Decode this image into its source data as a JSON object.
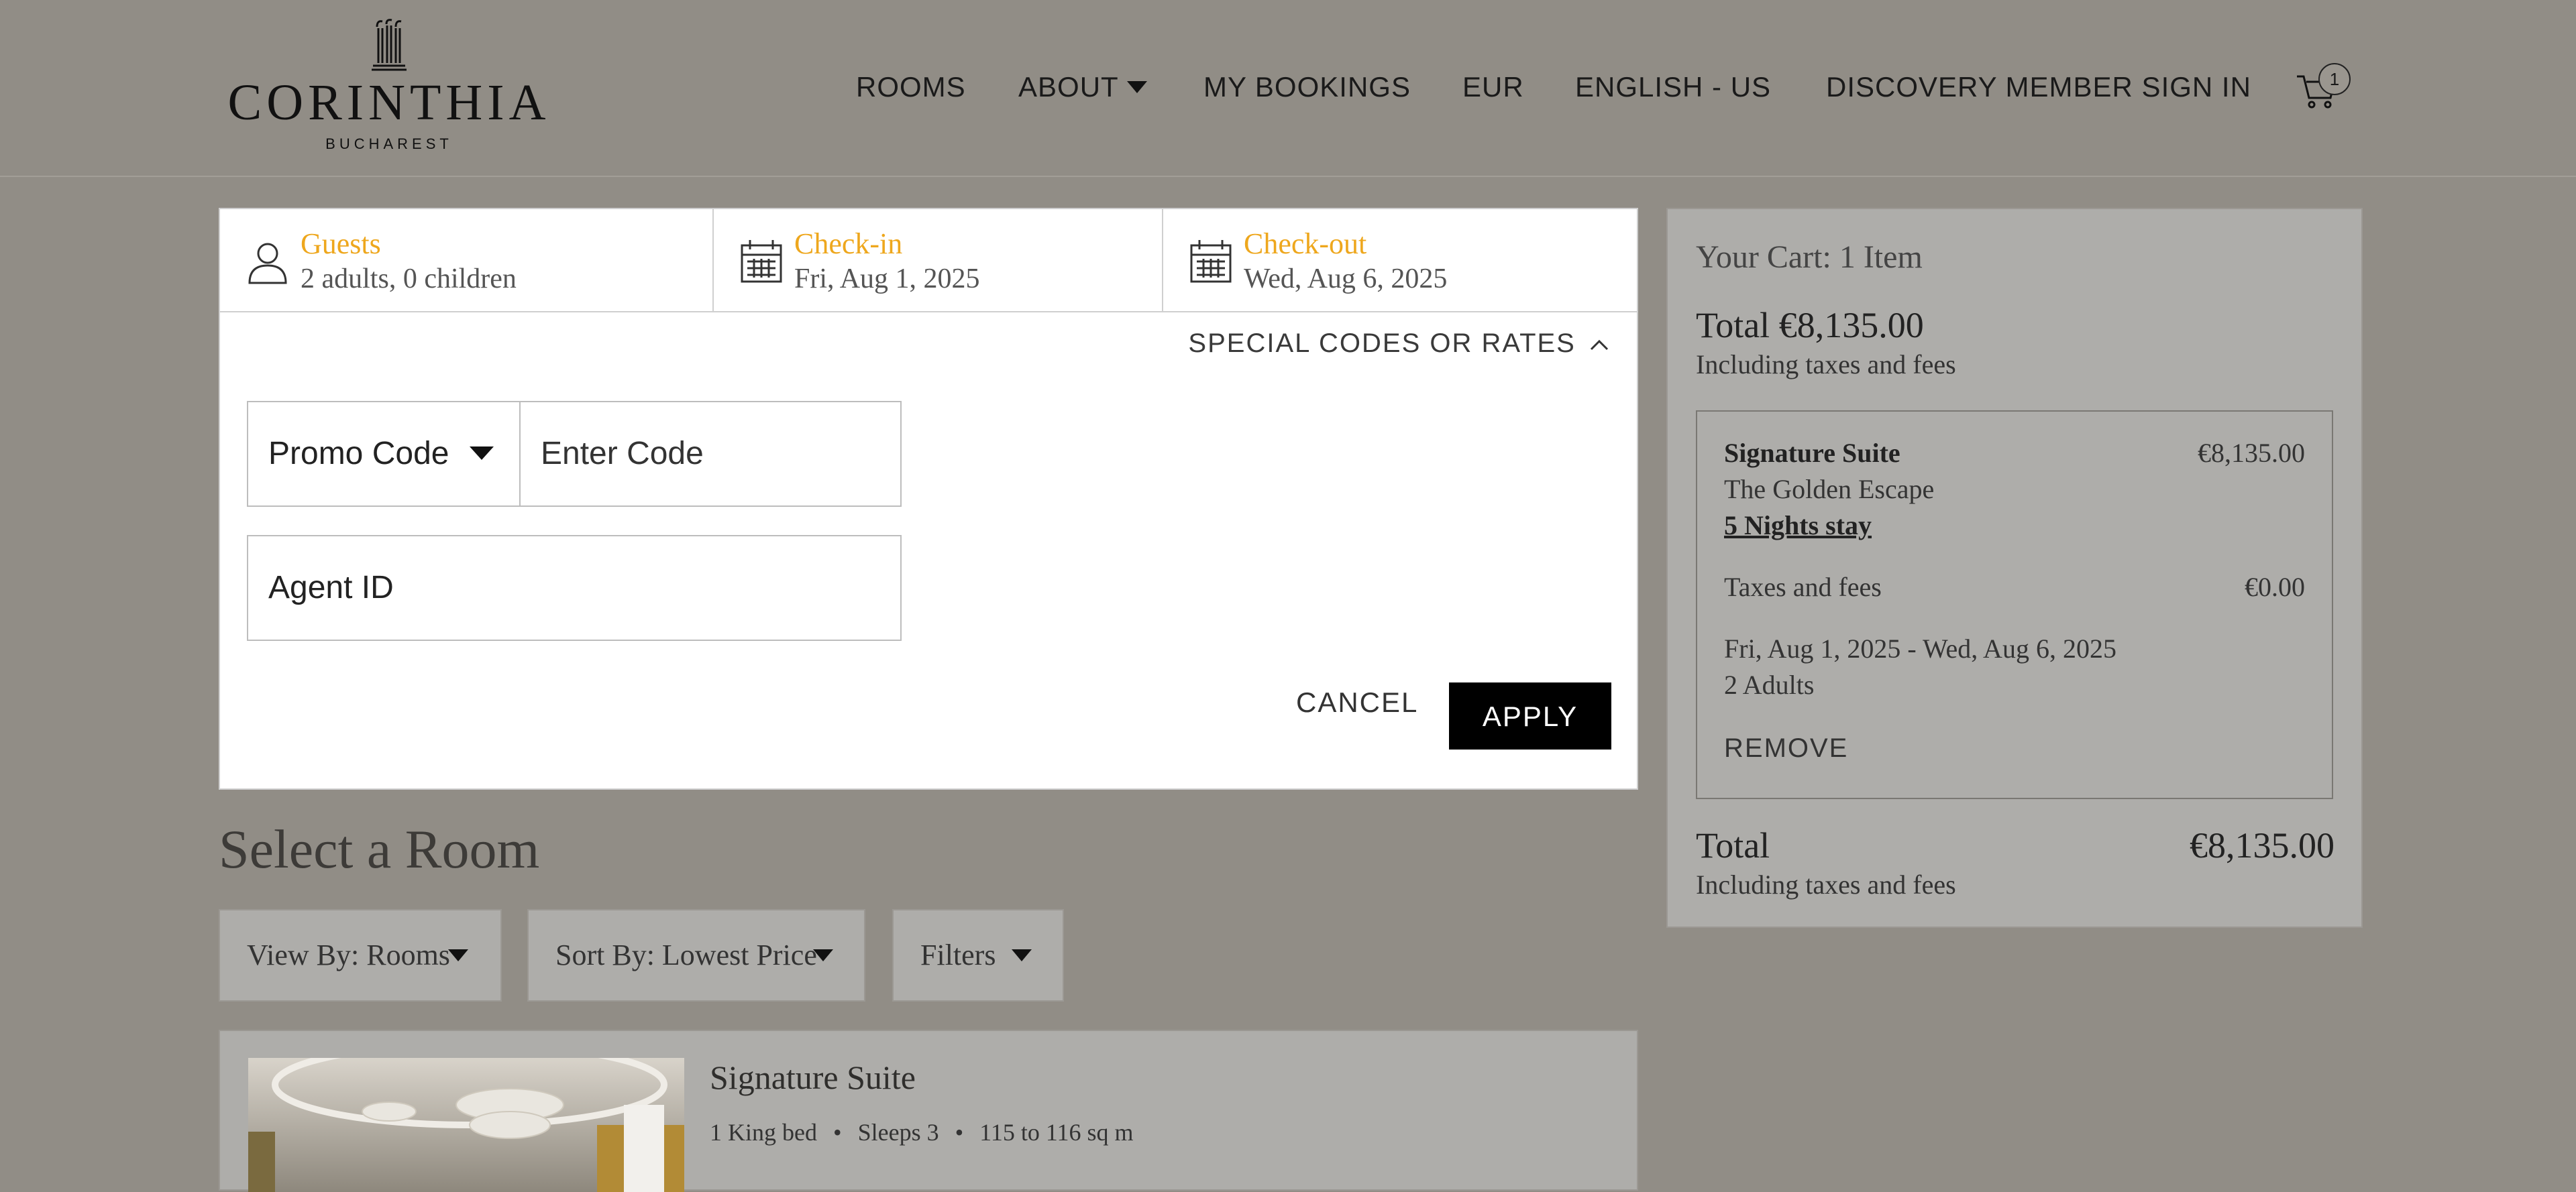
{
  "brand": {
    "name": "CORINTHIA",
    "city": "BUCHAREST"
  },
  "nav": {
    "rooms": "ROOMS",
    "about": "ABOUT",
    "my_bookings": "MY BOOKINGS",
    "currency": "EUR",
    "language": "ENGLISH - US",
    "sign_in": "DISCOVERY MEMBER SIGN IN",
    "cart_count": "1"
  },
  "search": {
    "guests_label": "Guests",
    "guests_value": "2 adults, 0 children",
    "checkin_label": "Check-in",
    "checkin_value": "Fri, Aug 1, 2025",
    "checkout_label": "Check-out",
    "checkout_value": "Wed, Aug 6, 2025",
    "special_label": "SPECIAL CODES OR RATES",
    "promo_select": "Promo Code",
    "code_placeholder": "Enter Code",
    "agent_placeholder": "Agent ID",
    "cancel": "CANCEL",
    "apply": "APPLY"
  },
  "rooms_section": {
    "title": "Select a Room",
    "view_by": "View By: Rooms",
    "sort_by": "Sort By: Lowest Price",
    "filters": "Filters"
  },
  "room": {
    "name": "Signature Suite",
    "bed": "1 King bed",
    "sleeps": "Sleeps 3",
    "size": "115 to 116 sq m"
  },
  "cart": {
    "title": "Your Cart: 1 Item",
    "total": "Total €8,135.00",
    "including": "Including taxes and fees",
    "item_name": "Signature Suite",
    "item_price": "€8,135.00",
    "item_package": "The Golden Escape",
    "item_nights": "5 Nights stay",
    "taxes_label": "Taxes and fees",
    "taxes_value": "€0.00",
    "dates": "Fri, Aug 1, 2025 - Wed, Aug 6, 2025",
    "adults": "2 Adults",
    "remove": "REMOVE",
    "grand_label": "Total",
    "grand_value": "€8,135.00",
    "grand_including": "Including taxes and fees"
  },
  "colors": {
    "overlay_bg": "#918d86",
    "accent_gold": "#eea71d",
    "apply_bg": "#000000"
  },
  "icons": [
    "logo-columns-icon",
    "chevron-down-icon",
    "cart-icon",
    "user-icon",
    "calendar-icon",
    "chevron-up-icon"
  ]
}
